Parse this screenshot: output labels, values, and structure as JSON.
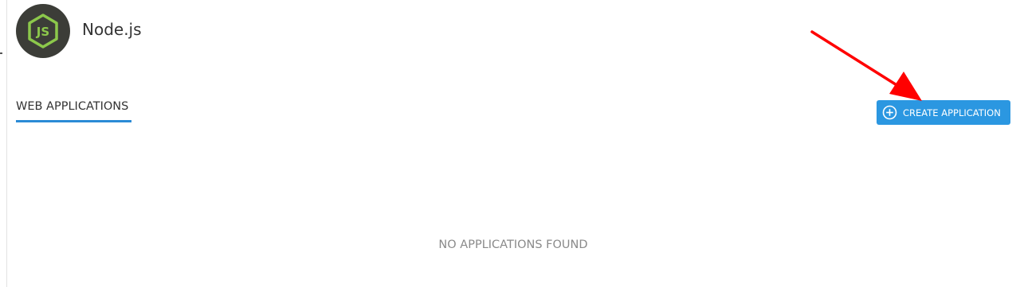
{
  "header": {
    "app_title": "Node.js",
    "logo_icon": "nodejs-logo-icon"
  },
  "tabs": [
    {
      "label": "WEB APPLICATIONS",
      "active": true
    }
  ],
  "toolbar": {
    "create_label": "CREATE APPLICATION",
    "create_icon": "plus-circle-icon"
  },
  "main": {
    "empty_message": "NO APPLICATIONS FOUND"
  },
  "annotation": {
    "arrow_color": "#ff0000"
  },
  "colors": {
    "accent": "#2b97e1",
    "tab_underline": "#2b8bd6",
    "logo_bg": "#3c3d38",
    "logo_green": "#8cc84b"
  }
}
